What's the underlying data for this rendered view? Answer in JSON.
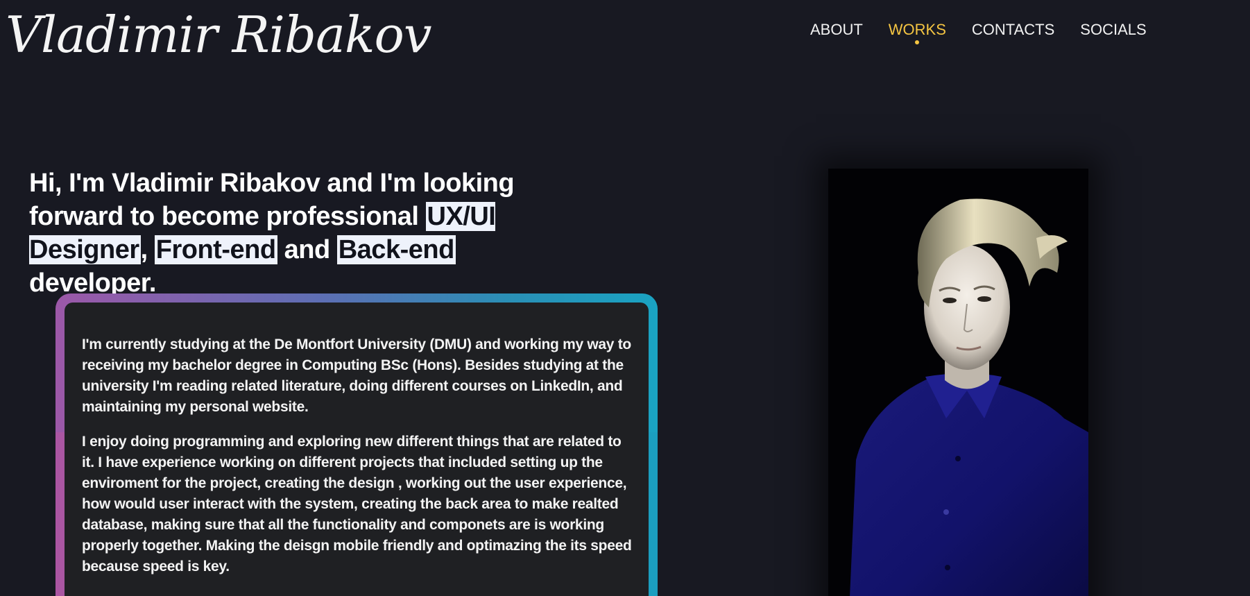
{
  "header": {
    "logo_text": "Vladimir Ribakov"
  },
  "nav": {
    "items": [
      {
        "label": "ABOUT",
        "active": false
      },
      {
        "label": "WORKS",
        "active": true
      },
      {
        "label": "CONTACTS",
        "active": false
      },
      {
        "label": "SOCIALS",
        "active": false
      }
    ],
    "active_color": "#f5c542"
  },
  "hero": {
    "heading_part1": "Hi, I'm Vladimir Ribakov and I'm looking forward to become professional ",
    "highlight1": "UX/UI Designer",
    "sep1": ", ",
    "highlight2": "Front-end",
    "sep2": " and ",
    "highlight3": "Back-end",
    "heading_end": " developer."
  },
  "about_card": {
    "paragraph1": "I'm currently studying at the De Montfort University (DMU) and working my way to receiving my bachelor degree in Computing BSc (Hons). Besides studying at the university I'm reading related literature, doing different courses on LinkedIn, and maintaining my personal website.",
    "paragraph2": "I enjoy doing programming and exploring new different things that are related to it. I have experience working on different projects that included setting up the enviroment for the project, creating the design , working out the user experience, how would user interact with the system, creating the back area to make realted database, making sure that all the functionality and componets are is working properly together. Making the deisgn mobile friendly and optimazing the its speed because speed is key.",
    "border_gradient": [
      "#9c58a8",
      "#5c6fb4",
      "#1aa3c2"
    ]
  },
  "portrait": {
    "icon": "portrait-photo"
  },
  "colors": {
    "background": "#181922",
    "card_background": "#1f2023",
    "highlight_background": "#eef2fb"
  }
}
